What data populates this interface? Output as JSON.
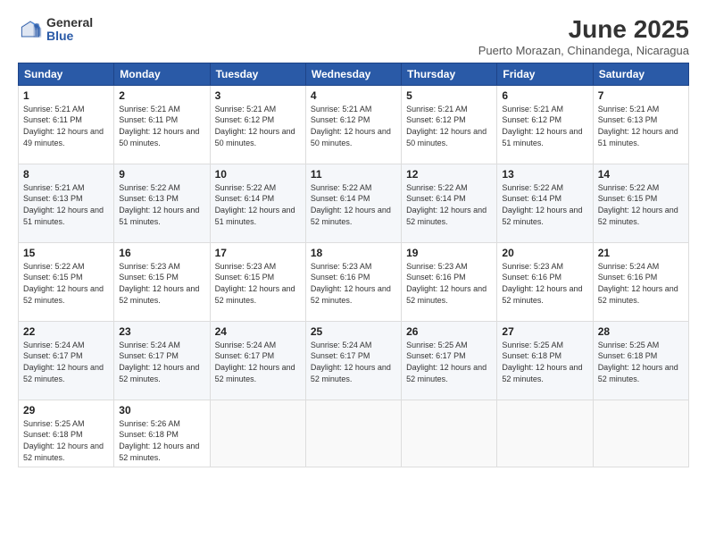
{
  "logo": {
    "general": "General",
    "blue": "Blue"
  },
  "title": "June 2025",
  "location": "Puerto Morazan, Chinandega, Nicaragua",
  "weekdays": [
    "Sunday",
    "Monday",
    "Tuesday",
    "Wednesday",
    "Thursday",
    "Friday",
    "Saturday"
  ],
  "weeks": [
    [
      {
        "day": "1",
        "sunrise": "5:21 AM",
        "sunset": "6:11 PM",
        "daylight": "12 hours and 49 minutes."
      },
      {
        "day": "2",
        "sunrise": "5:21 AM",
        "sunset": "6:11 PM",
        "daylight": "12 hours and 50 minutes."
      },
      {
        "day": "3",
        "sunrise": "5:21 AM",
        "sunset": "6:12 PM",
        "daylight": "12 hours and 50 minutes."
      },
      {
        "day": "4",
        "sunrise": "5:21 AM",
        "sunset": "6:12 PM",
        "daylight": "12 hours and 50 minutes."
      },
      {
        "day": "5",
        "sunrise": "5:21 AM",
        "sunset": "6:12 PM",
        "daylight": "12 hours and 50 minutes."
      },
      {
        "day": "6",
        "sunrise": "5:21 AM",
        "sunset": "6:12 PM",
        "daylight": "12 hours and 51 minutes."
      },
      {
        "day": "7",
        "sunrise": "5:21 AM",
        "sunset": "6:13 PM",
        "daylight": "12 hours and 51 minutes."
      }
    ],
    [
      {
        "day": "8",
        "sunrise": "5:21 AM",
        "sunset": "6:13 PM",
        "daylight": "12 hours and 51 minutes."
      },
      {
        "day": "9",
        "sunrise": "5:22 AM",
        "sunset": "6:13 PM",
        "daylight": "12 hours and 51 minutes."
      },
      {
        "day": "10",
        "sunrise": "5:22 AM",
        "sunset": "6:14 PM",
        "daylight": "12 hours and 51 minutes."
      },
      {
        "day": "11",
        "sunrise": "5:22 AM",
        "sunset": "6:14 PM",
        "daylight": "12 hours and 52 minutes."
      },
      {
        "day": "12",
        "sunrise": "5:22 AM",
        "sunset": "6:14 PM",
        "daylight": "12 hours and 52 minutes."
      },
      {
        "day": "13",
        "sunrise": "5:22 AM",
        "sunset": "6:14 PM",
        "daylight": "12 hours and 52 minutes."
      },
      {
        "day": "14",
        "sunrise": "5:22 AM",
        "sunset": "6:15 PM",
        "daylight": "12 hours and 52 minutes."
      }
    ],
    [
      {
        "day": "15",
        "sunrise": "5:22 AM",
        "sunset": "6:15 PM",
        "daylight": "12 hours and 52 minutes."
      },
      {
        "day": "16",
        "sunrise": "5:23 AM",
        "sunset": "6:15 PM",
        "daylight": "12 hours and 52 minutes."
      },
      {
        "day": "17",
        "sunrise": "5:23 AM",
        "sunset": "6:15 PM",
        "daylight": "12 hours and 52 minutes."
      },
      {
        "day": "18",
        "sunrise": "5:23 AM",
        "sunset": "6:16 PM",
        "daylight": "12 hours and 52 minutes."
      },
      {
        "day": "19",
        "sunrise": "5:23 AM",
        "sunset": "6:16 PM",
        "daylight": "12 hours and 52 minutes."
      },
      {
        "day": "20",
        "sunrise": "5:23 AM",
        "sunset": "6:16 PM",
        "daylight": "12 hours and 52 minutes."
      },
      {
        "day": "21",
        "sunrise": "5:24 AM",
        "sunset": "6:16 PM",
        "daylight": "12 hours and 52 minutes."
      }
    ],
    [
      {
        "day": "22",
        "sunrise": "5:24 AM",
        "sunset": "6:17 PM",
        "daylight": "12 hours and 52 minutes."
      },
      {
        "day": "23",
        "sunrise": "5:24 AM",
        "sunset": "6:17 PM",
        "daylight": "12 hours and 52 minutes."
      },
      {
        "day": "24",
        "sunrise": "5:24 AM",
        "sunset": "6:17 PM",
        "daylight": "12 hours and 52 minutes."
      },
      {
        "day": "25",
        "sunrise": "5:24 AM",
        "sunset": "6:17 PM",
        "daylight": "12 hours and 52 minutes."
      },
      {
        "day": "26",
        "sunrise": "5:25 AM",
        "sunset": "6:17 PM",
        "daylight": "12 hours and 52 minutes."
      },
      {
        "day": "27",
        "sunrise": "5:25 AM",
        "sunset": "6:18 PM",
        "daylight": "12 hours and 52 minutes."
      },
      {
        "day": "28",
        "sunrise": "5:25 AM",
        "sunset": "6:18 PM",
        "daylight": "12 hours and 52 minutes."
      }
    ],
    [
      {
        "day": "29",
        "sunrise": "5:25 AM",
        "sunset": "6:18 PM",
        "daylight": "12 hours and 52 minutes."
      },
      {
        "day": "30",
        "sunrise": "5:26 AM",
        "sunset": "6:18 PM",
        "daylight": "12 hours and 52 minutes."
      },
      null,
      null,
      null,
      null,
      null
    ]
  ]
}
